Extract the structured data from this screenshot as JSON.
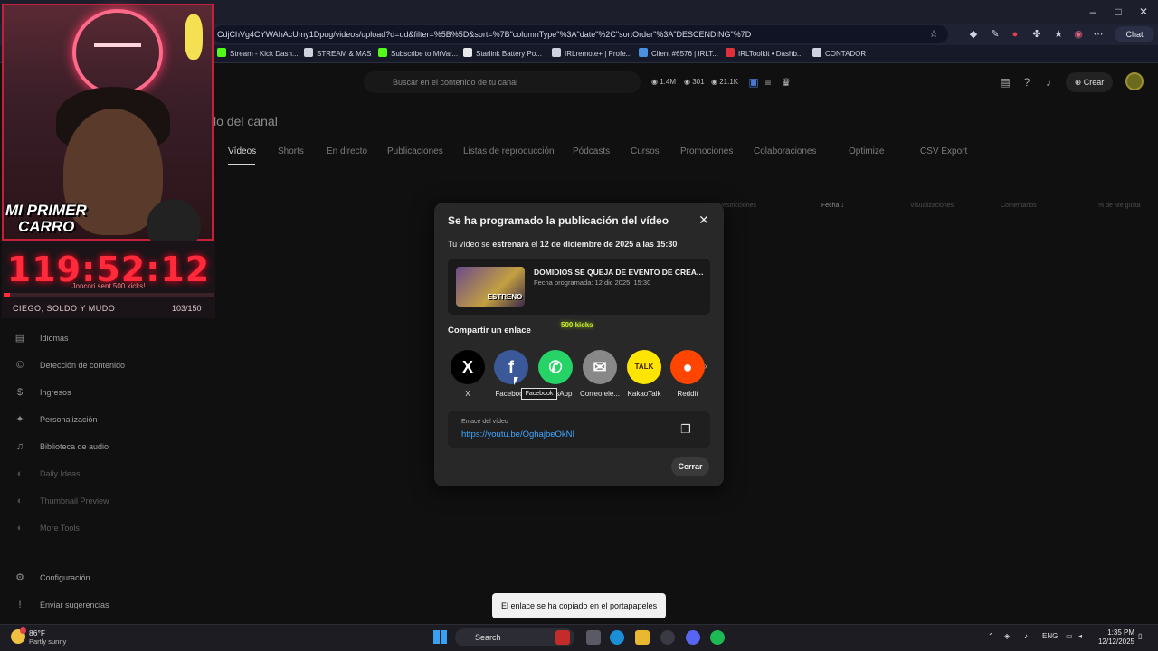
{
  "browser": {
    "url": "CdjChVg4CYWAhAcUmy1Dpug/videos/upload?d=ud&filter=%5B%5D&sort=%7B\"columnType\"%3A\"date\"%2C\"sortOrder\"%3A\"DESCENDING\"%7D",
    "chat_label": "Chat",
    "bookmarks": [
      {
        "label": "Stream - Kick Dash...",
        "color": "#53fc18"
      },
      {
        "label": "STREAM & MAS",
        "color": "#cfd3e0"
      },
      {
        "label": "Subscribe to MrVar...",
        "color": "#53fc18"
      },
      {
        "label": "Starlink Battery Po...",
        "color": "#e8e8e8"
      },
      {
        "label": "IRLremote+ | Profe...",
        "color": "#cfd3e0"
      },
      {
        "label": "Client #6576 | IRLT...",
        "color": "#4a90e2"
      },
      {
        "label": "IRLToolkit • Dashb...",
        "color": "#e0303a"
      },
      {
        "label": "CONTADOR",
        "color": "#cfd3e0"
      }
    ]
  },
  "studio": {
    "search_placeholder": "Buscar en el contenido de tu canal",
    "stats": {
      "subs": "1.4M",
      "count_b": "301",
      "count_c": "21.1K"
    },
    "create_label": "Crear",
    "page_heading": "lo del canal",
    "tabs": [
      "Vídeos",
      "Shorts",
      "En directo",
      "Publicaciones",
      "Listas de reproducción",
      "Pódcasts",
      "Cursos",
      "Promociones",
      "Colaboraciones",
      "Optimize",
      "CSV Export"
    ],
    "columns": [
      "Restricciones",
      "Fecha ↓",
      "Visualizaciones",
      "Comentarios",
      "% de Me gusta"
    ],
    "sidebar": [
      {
        "label": "Idiomas",
        "icon": "languages-icon",
        "glyph": "▤",
        "dim": false
      },
      {
        "label": "Detección de contenido",
        "icon": "copyright-icon",
        "glyph": "©",
        "dim": false
      },
      {
        "label": "Ingresos",
        "icon": "dollar-icon",
        "glyph": "$",
        "dim": false
      },
      {
        "label": "Personalización",
        "icon": "magic-wand-icon",
        "glyph": "✦",
        "dim": false
      },
      {
        "label": "Biblioteca de audio",
        "icon": "audio-library-icon",
        "glyph": "♫",
        "dim": false
      },
      {
        "label": "Daily Ideas",
        "icon": "ideas-icon",
        "glyph": "◐",
        "dim": true
      },
      {
        "label": "Thumbnail Preview",
        "icon": "thumbnail-icon",
        "glyph": "◐",
        "dim": true
      },
      {
        "label": "More Tools",
        "icon": "tools-icon",
        "glyph": "◐",
        "dim": true
      },
      {
        "label": "Configuración",
        "icon": "gear-icon",
        "glyph": "⚙",
        "dim": false
      },
      {
        "label": "Enviar sugerencias",
        "icon": "feedback-icon",
        "glyph": "!",
        "dim": false
      }
    ]
  },
  "overlay": {
    "promo_line1": "MI PRIMER",
    "promo_line2": "CARRO",
    "timer": "119:52:12",
    "kick_message": "Joncori sent 500 kicks!",
    "goal_label": "CIEGO, SOLDO Y MUDO",
    "goal_count": "103/150",
    "goal_progress": 0.03
  },
  "modal": {
    "title": "Se ha programado la publicación del vídeo",
    "sched_prefix": "Tu vídeo se ",
    "sched_verb": "estrenará",
    "sched_mid": " el ",
    "sched_date": "12 de diciembre de 2025 a las 15:30",
    "video_title": "DOMIDIOS SE QUEJA DE EVENTO DE CREATIVOS...",
    "video_date": "Fecha programada: 12 dic 2025, 15:30",
    "thumb_badge": "ESTRENO",
    "share_heading": "Compartir un enlace",
    "kicks_float": "500 kicks",
    "share_targets": [
      {
        "label": "X",
        "glyph": "X",
        "bg": "#000000",
        "fg": "#ffffff",
        "icon": "x-logo-icon"
      },
      {
        "label": "Facebook",
        "glyph": "f",
        "bg": "#3b5998",
        "fg": "#ffffff",
        "icon": "facebook-icon"
      },
      {
        "label": "WhatsApp",
        "glyph": "✆",
        "bg": "#25d366",
        "fg": "#ffffff",
        "icon": "whatsapp-icon"
      },
      {
        "label": "Correo ele...",
        "glyph": "✉",
        "bg": "#888888",
        "fg": "#ffffff",
        "icon": "email-icon"
      },
      {
        "label": "KakaoTalk",
        "glyph": "TALK",
        "bg": "#fee500",
        "fg": "#3a1d1d",
        "icon": "kakaotalk-icon"
      },
      {
        "label": "Reddit",
        "glyph": "●",
        "bg": "#ff4500",
        "fg": "#ffffff",
        "icon": "reddit-icon"
      }
    ],
    "tooltip": "Facebook",
    "link_label": "Enlace del vídeo",
    "link_url": "https://youtu.be/OghajbeOkNI",
    "close_label": "Cerrar"
  },
  "snackbar": "El enlace se ha copiado en el portapapeles",
  "taskbar": {
    "weather_temp": "86°F",
    "weather_desc": "Partly sunny",
    "search_label": "Search",
    "lang": "ENG",
    "time": "1:35 PM",
    "date": "12/12/2025"
  }
}
